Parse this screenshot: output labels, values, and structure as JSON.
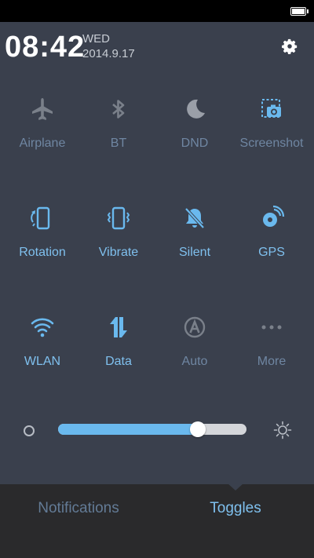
{
  "header": {
    "time": "08:42",
    "day": "WED",
    "date": "2014.9.17"
  },
  "toggles": [
    {
      "label": "Airplane",
      "icon": "airplane-icon",
      "state": "off"
    },
    {
      "label": "BT",
      "icon": "bluetooth-icon",
      "state": "off"
    },
    {
      "label": "DND",
      "icon": "moon-icon",
      "state": "off"
    },
    {
      "label": "Screenshot",
      "icon": "screenshot-icon",
      "state": "off"
    },
    {
      "label": "Rotation",
      "icon": "rotation-icon",
      "state": "on"
    },
    {
      "label": "Vibrate",
      "icon": "vibrate-icon",
      "state": "on"
    },
    {
      "label": "Silent",
      "icon": "silent-bell-icon",
      "state": "on"
    },
    {
      "label": "GPS",
      "icon": "gps-icon",
      "state": "on"
    },
    {
      "label": "WLAN",
      "icon": "wifi-icon",
      "state": "on"
    },
    {
      "label": "Data",
      "icon": "data-arrows-icon",
      "state": "on"
    },
    {
      "label": "Auto",
      "icon": "auto-icon",
      "state": "off"
    },
    {
      "label": "More",
      "icon": "more-dots-icon",
      "state": "off"
    }
  ],
  "brightness": {
    "level": 0.74
  },
  "bottom_tabs": {
    "notifications": "Notifications",
    "toggles": "Toggles",
    "active": "toggles"
  },
  "colors": {
    "panel_bg": "#3a404d",
    "active": "#7fc0ee",
    "inactive_label": "#6f86a2",
    "bottom_bg": "#2a2a2c"
  }
}
